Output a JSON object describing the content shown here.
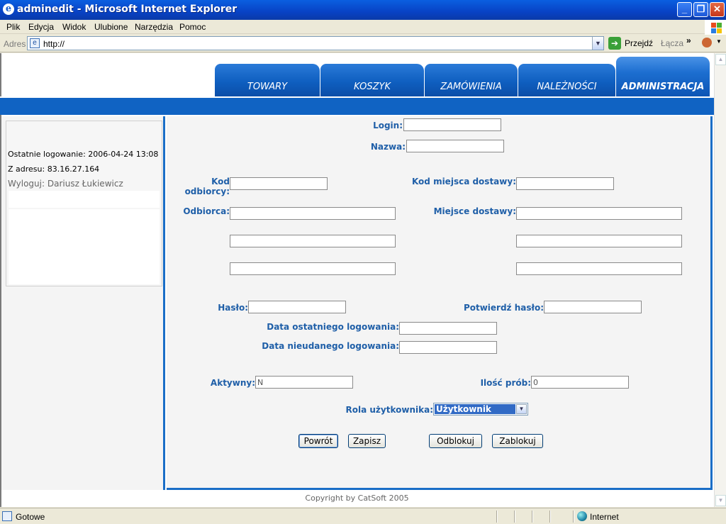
{
  "window": {
    "title": "adminedit - Microsoft Internet Explorer",
    "ie_icon_letter": "e",
    "minimize_glyph": "_",
    "maximize_glyph": "❐",
    "close_glyph": "✕"
  },
  "menu": [
    "Plik",
    "Edycja",
    "Widok",
    "Ulubione",
    "Narzędzia",
    "Pomoc"
  ],
  "address_bar": {
    "label": "Adres",
    "value": "http://",
    "go_label": "Przejdź",
    "links_label": "Łącza",
    "chevron": "»"
  },
  "tabs": [
    {
      "label": "TOWARY",
      "active": false
    },
    {
      "label": "KOSZYK",
      "active": false
    },
    {
      "label": "ZAMÓWIENIA",
      "active": false
    },
    {
      "label": "NALEŻNOŚCI",
      "active": false
    },
    {
      "label": "ADMINISTRACJA",
      "active": true
    }
  ],
  "left_panel": {
    "last_login": "Ostatnie logowanie: 2006-04-24 13:08",
    "from_address": "Z adresu: 83.16.27.164",
    "logout": "Wyloguj: Dariusz Łukiewicz"
  },
  "form": {
    "login_label": "Login:",
    "login_value": "",
    "nazwa_label": "Nazwa:",
    "nazwa_value": "",
    "kod_odbiorcy_label": "Kod odbiorcy:",
    "kod_odbiorcy_value": "",
    "kod_miejsca_label": "Kod miejsca dostawy:",
    "kod_miejsca_value": "",
    "odbiorca_label": "Odbiorca:",
    "miejsce_label": "Miejsce dostawy:",
    "haslo_label": "Hasło:",
    "haslo_value": "",
    "potwierdz_label": "Potwierdź hasło:",
    "potwierdz_value": "",
    "data_ost_label": "Data ostatniego logowania:",
    "data_ost_value": "",
    "data_nieud_label": "Data nieudanego logowania:",
    "data_nieud_value": "",
    "aktywny_label": "Aktywny:",
    "aktywny_value": "N",
    "ilosc_label": "Ilość prób:",
    "ilosc_value": "0",
    "rola_label": "Rola użytkownika:",
    "rola_value": "Użytkownik"
  },
  "buttons": {
    "powrot": "Powrót",
    "zapisz": "Zapisz",
    "odblokuj": "Odblokuj",
    "zablokuj": "Zablokuj"
  },
  "footer": "Copyright by CatSoft 2005",
  "status": {
    "text": "Gotowe",
    "zone": "Internet"
  },
  "colors": {
    "tab_blue": "#0f5fc0",
    "label_blue": "#1f5fa8",
    "xp_title": "#0842c5"
  }
}
